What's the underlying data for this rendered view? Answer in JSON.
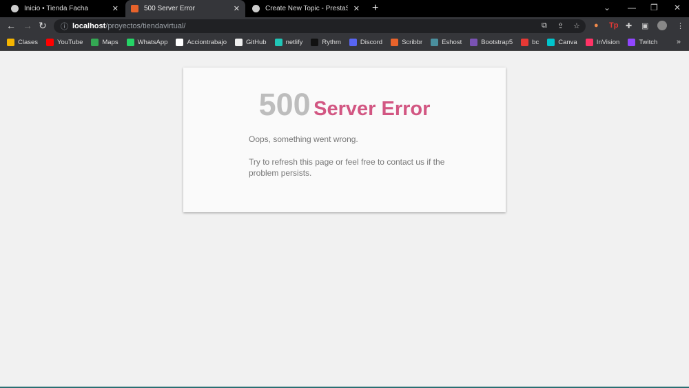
{
  "tabs": [
    {
      "label": "Inicio • Tienda Facha",
      "active": false
    },
    {
      "label": "500 Server Error",
      "active": true
    },
    {
      "label": "Create New Topic - PrestaShop F",
      "active": false
    }
  ],
  "address": {
    "host": "localhost",
    "path": "/proyectos/tiendavirtual/"
  },
  "bookmarks": [
    {
      "label": "Clases",
      "color": "#f4b400"
    },
    {
      "label": "YouTube",
      "color": "#ff0000"
    },
    {
      "label": "Maps",
      "color": "#34a853"
    },
    {
      "label": "WhatsApp",
      "color": "#25d366"
    },
    {
      "label": "Acciontrabajo",
      "color": "#ffffff"
    },
    {
      "label": "GitHub",
      "color": "#eeeeee"
    },
    {
      "label": "netlify",
      "color": "#20c6b7"
    },
    {
      "label": "Rythm",
      "color": "#111111"
    },
    {
      "label": "Discord",
      "color": "#5865f2"
    },
    {
      "label": "Scribbr",
      "color": "#e8632b"
    },
    {
      "label": "Eshost",
      "color": "#4a8f9e"
    },
    {
      "label": "Bootstrap5",
      "color": "#7952b3"
    },
    {
      "label": "bc",
      "color": "#e53935"
    },
    {
      "label": "Canva",
      "color": "#00c4cc"
    },
    {
      "label": "InVision",
      "color": "#ff3366"
    },
    {
      "label": "Twitch",
      "color": "#9146ff"
    }
  ],
  "error": {
    "code": "500",
    "message": "Server Error",
    "line1": "Oops, something went wrong.",
    "line2": "Try to refresh this page or feel free to contact us if the problem persists."
  }
}
